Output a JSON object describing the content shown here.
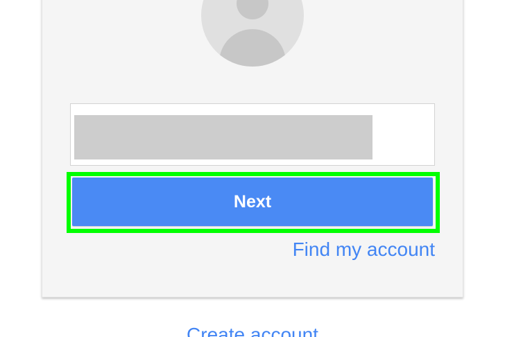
{
  "signin": {
    "email_field": {
      "value": "",
      "redacted": true
    },
    "next_label": "Next",
    "find_account_label": "Find my account",
    "create_account_label": "Create account"
  },
  "colors": {
    "card_background": "#f5f5f5",
    "primary_button": "#4a8af4",
    "link": "#4285f4",
    "highlight": "#00ff00",
    "avatar": "#e0e0e0"
  },
  "icons": {
    "avatar": "user-avatar-placeholder-icon"
  }
}
